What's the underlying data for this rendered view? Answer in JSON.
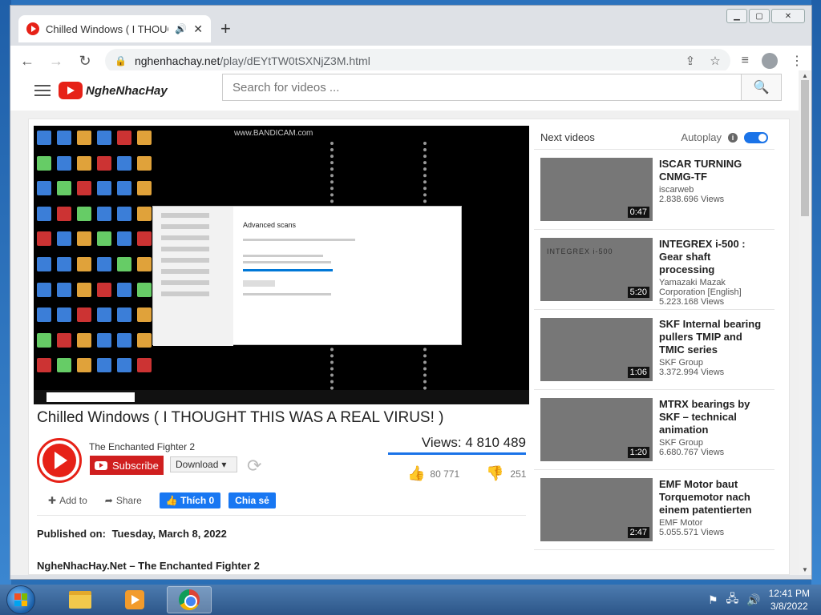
{
  "browser": {
    "tab_title": "Chilled Windows ( I THOUGHT",
    "url_host": "nghenhachay.net",
    "url_path": "/play/dEYtTW0tSXNjZ3M.html"
  },
  "site": {
    "logo_text": "NgheNhacHay",
    "search_placeholder": "Search for videos ..."
  },
  "video": {
    "title": "Chilled Windows ( I THOUGHT THIS WAS A REAL VIRUS! )",
    "overlay_watermark": "www.BANDICAM.com",
    "defender_title": "Advanced scans",
    "channel": "The Enchanted Fighter 2",
    "subscribe_label": "Subscribe",
    "download_label": "Download",
    "views": "Views: 4 810 489",
    "likes": "80 771",
    "dislikes": "251",
    "add_to": "Add to",
    "share": "Share",
    "fb_like": "Thích 0",
    "fb_share": "Chia sẻ",
    "published_label": "Published on:",
    "published_date": "Tuesday, March 8, 2022",
    "credits": "NgheNhacHay.Net – The Enchanted Fighter 2"
  },
  "sidebar": {
    "heading": "Next videos",
    "autoplay": "Autoplay",
    "items": [
      {
        "title": "ISCAR TURNING CNMG-TF",
        "channel": "iscarweb",
        "views": "2.838.696 Views",
        "duration": "0:47"
      },
      {
        "title": "INTEGREX i-500 : Gear shaft processing",
        "channel": "Yamazaki Mazak Corporation [English]",
        "views": "5.223.168 Views",
        "duration": "5:20",
        "thumb_text": "INTEGREX i-500"
      },
      {
        "title": "SKF Internal bearing pullers TMIP and TMIC series",
        "channel": "SKF Group",
        "views": "3.372.994 Views",
        "duration": "1:06"
      },
      {
        "title": "MTRX bearings by SKF – technical animation",
        "channel": "SKF Group",
        "views": "6.680.767 Views",
        "duration": "1:20"
      },
      {
        "title": "EMF Motor baut Torquemotor nach einem patentierten",
        "channel": "EMF Motor",
        "views": "5.055.571 Views",
        "duration": "2:47"
      }
    ]
  },
  "taskbar": {
    "time": "12:41 PM",
    "date": "3/8/2022"
  }
}
